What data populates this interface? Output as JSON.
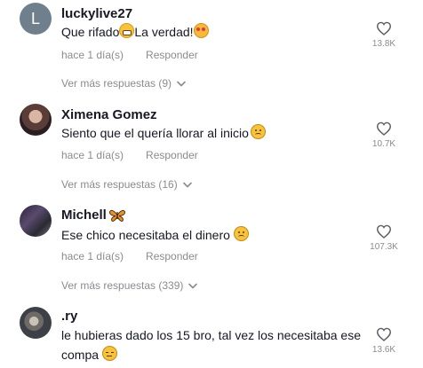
{
  "comments": [
    {
      "username": "luckylive27",
      "avatar_letter": "L",
      "text_a": "Que rifado",
      "text_b": "La verdad!",
      "time": "hace 1 día(s)",
      "reply": "Responder",
      "replies": "Ver más respuestas (9)",
      "likes": "13.8K"
    },
    {
      "username": "Ximena Gomez",
      "text_a": "Siento que el quería llorar al inicio",
      "time": "hace 1 día(s)",
      "reply": "Responder",
      "replies": "Ver más respuestas (16)",
      "likes": "10.7K"
    },
    {
      "username": "Michell",
      "text_a": "Ese chico necesitaba el dinero ",
      "time": "hace 1 día(s)",
      "reply": "Responder",
      "replies": "Ver más respuestas (339)",
      "likes": "107.3K"
    },
    {
      "username": ".ry",
      "text_a": "le hubieras dado los 15 bro, tal vez los necesitaba ese compa ",
      "likes": "13.6K"
    }
  ],
  "icons": {
    "like": "heart-outline-icon",
    "expand": "chevron-down-icon"
  },
  "colors": {
    "text": "#161823",
    "secondary": "#8a8b91",
    "avatar_bg": "#707f8c"
  }
}
